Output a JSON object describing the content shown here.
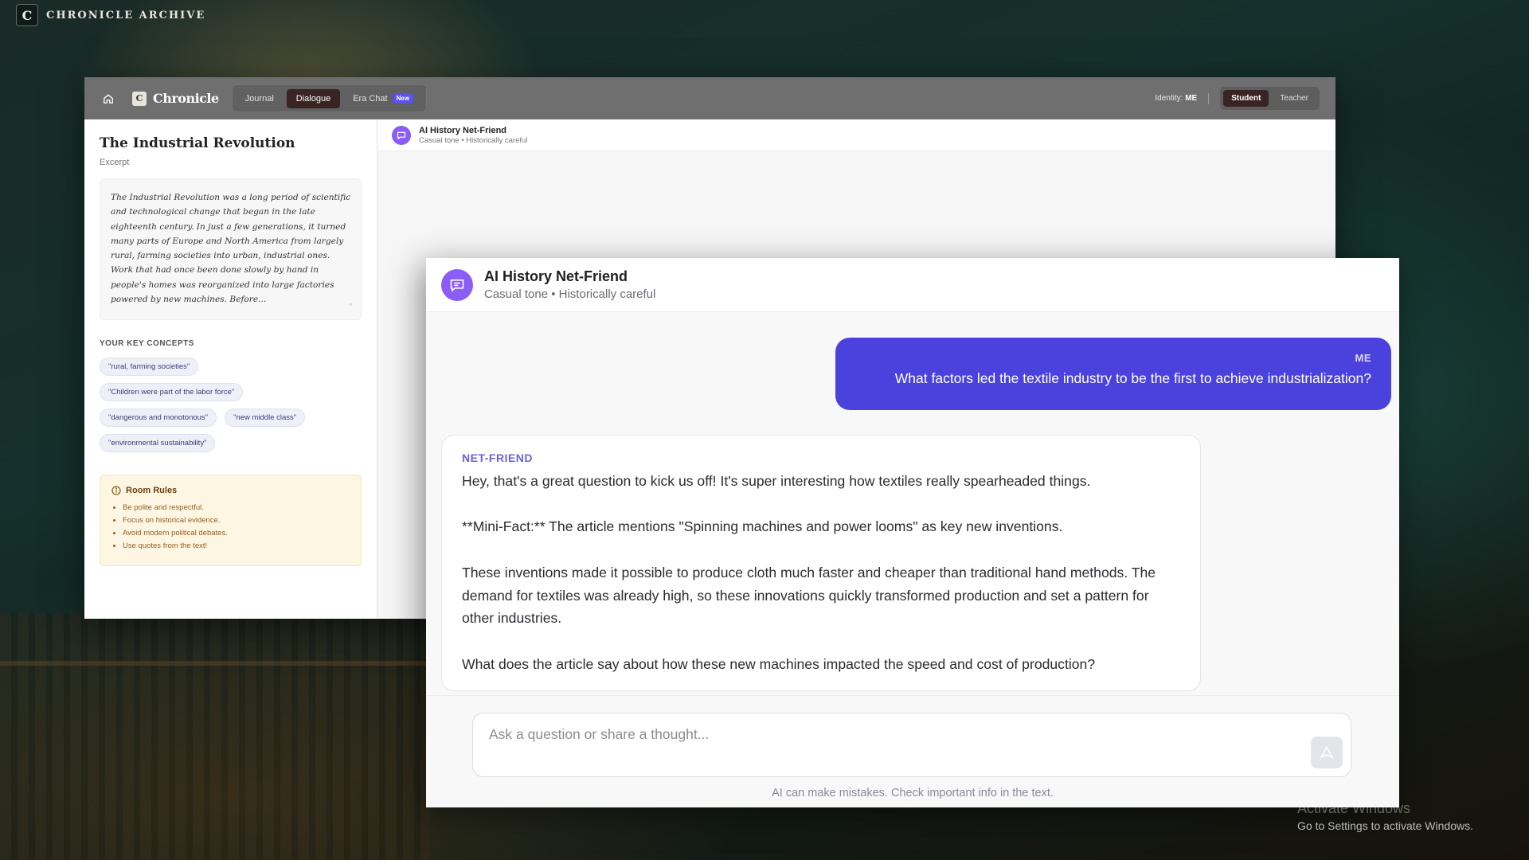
{
  "brand": {
    "logo_letter": "C",
    "name": "CHRONICLE ARCHIVE"
  },
  "app": {
    "logo_letter": "C",
    "logo_name": "Chronicle",
    "tabs": [
      {
        "label": "Journal",
        "active": false
      },
      {
        "label": "Dialogue",
        "active": true
      },
      {
        "label": "Era Chat",
        "active": false,
        "badge": "New"
      }
    ],
    "identity_label": "Identity:",
    "identity_value": "ME",
    "roles": [
      {
        "label": "Student",
        "active": true
      },
      {
        "label": "Teacher",
        "active": false
      }
    ]
  },
  "left_panel": {
    "title": "The Industrial Revolution",
    "subtitle": "Excerpt",
    "excerpt": "The Industrial Revolution was a long period of scientific and technological change that began in the late eighteenth century. In just a few generations, it turned many parts of Europe and North America from largely rural, farming societies into urban, industrial ones. Work that had once been done slowly by hand in people's homes was reorganized into large factories powered by new machines. Before...",
    "concepts_label": "YOUR KEY CONCEPTS",
    "concepts": [
      "\"rural, farming societies\"",
      "\"Children were part of the labor force\"",
      "\"dangerous and monotonous\"",
      "\"new middle class\"",
      "\"environmental sustainability\""
    ],
    "rules_title": "Room Rules",
    "rules": [
      "Be polite and respectful.",
      "Focus on historical evidence.",
      "Avoid modern political debates.",
      "Use quotes from the text!"
    ]
  },
  "bot": {
    "name": "AI History Net-Friend",
    "subtitle": "Casual tone • Historically careful"
  },
  "chat": {
    "me_label": "ME",
    "me_text": "What factors led the textile industry to be the first to achieve industrialization?",
    "ai_label": "NET-FRIEND",
    "ai_text": "Hey, that's a great question to kick us off! It's super interesting how textiles really spearheaded things.\n\n**Mini-Fact:** The article mentions \"Spinning machines and power looms\" as key new inventions.\n\nThese inventions made it possible to produce cloth much faster and cheaper than traditional hand methods. The demand for textiles was already high, so these innovations quickly transformed production and set a pattern for other industries.\n\nWhat does the article say about how these new machines impacted the speed and cost of production?",
    "input_placeholder": "Ask a question or share a thought...",
    "disclaimer": "AI can make mistakes. Check important info in the text."
  },
  "watermark": {
    "line1": "Activate Windows",
    "line2": "Go to Settings to activate Windows."
  },
  "colors": {
    "accent": "#4b42dd",
    "avatar": "#8b5cf6",
    "header": "#6f6f6f",
    "active_tab": "#3a2323"
  },
  "icons": {
    "home": "home-icon",
    "chat": "chat-bubble-icon",
    "info": "info-circle-icon",
    "send": "send-icon"
  }
}
